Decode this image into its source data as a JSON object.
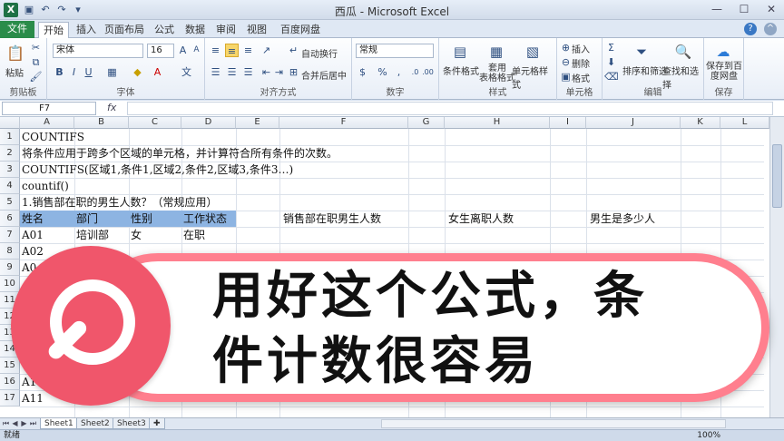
{
  "window": {
    "app_icon": "X",
    "title": "西瓜 - Microsoft Excel"
  },
  "tabs": [
    "文件",
    "开始",
    "插入",
    "页面布局",
    "公式",
    "数据",
    "审阅",
    "视图",
    "百度网盘"
  ],
  "ribbon": {
    "clipboard": {
      "paste": "粘贴",
      "label": "剪贴板"
    },
    "font": {
      "name": "宋体",
      "size": "16",
      "label": "字体",
      "bold": "B",
      "italic": "I",
      "underline": "U"
    },
    "alignment": {
      "wrap": "自动换行",
      "merge": "合并后居中",
      "label": "对齐方式"
    },
    "number": {
      "format": "常规",
      "label": "数字"
    },
    "styles": {
      "conditional": "条件格式",
      "table": "套用\n表格格式",
      "cell_styles": "单元格样式",
      "label": "样式"
    },
    "cells": {
      "insert": "插入",
      "delete": "删除",
      "format": "格式",
      "label": "单元格"
    },
    "editing": {
      "sort_filter": "排序和筛选",
      "find_select": "查找和选择",
      "label": "编辑"
    },
    "save": {
      "save_baidu": "保存到百\n度网盘",
      "label": "保存"
    }
  },
  "formula_bar": {
    "name_box": "F7",
    "fx": "fx",
    "formula": ""
  },
  "columns": [
    "A",
    "B",
    "C",
    "D",
    "E",
    "F",
    "G",
    "H",
    "I",
    "J",
    "K",
    "L"
  ],
  "rows": [
    "1",
    "2",
    "3",
    "4",
    "5",
    "6",
    "7",
    "8",
    "9",
    "10",
    "11",
    "12",
    "13",
    "14",
    "15",
    "16",
    "17"
  ],
  "cells": {
    "r1": "COUNTIFS",
    "r2": "将条件应用于跨多个区域的单元格，并计算符合所有条件的次数。",
    "r3": "COUNTIFS(区域1,条件1,区域2,条件2,区域3,条件3…)",
    "r4": "countif()",
    "r5": "1.销售部在职的男生人数？（常规应用）",
    "r6": {
      "a": "姓名",
      "b": "部门",
      "c": "性别",
      "d": "工作状态",
      "f": "销售部在职男生人数",
      "h": "女生离职人数",
      "j": "男生是多少人"
    },
    "r7": {
      "a": "A01",
      "b": "培训部",
      "c": "女",
      "d": "在职"
    },
    "r8": {
      "a": "A02"
    },
    "r9": {
      "a": "A0"
    },
    "r16": {
      "a": "A1"
    },
    "r17": {
      "a": "A11"
    }
  },
  "sheets": [
    "Sheet1",
    "Sheet2",
    "Sheet3"
  ],
  "status": {
    "ready": "就绪",
    "zoom": "100%"
  },
  "banner": {
    "line1": "用好这个公式，条",
    "line2": "件计数很容易"
  },
  "colors": {
    "header_fill": "#8db4e2",
    "banner_pink": "#f0566b",
    "banner_border": "#ff7f8e"
  }
}
